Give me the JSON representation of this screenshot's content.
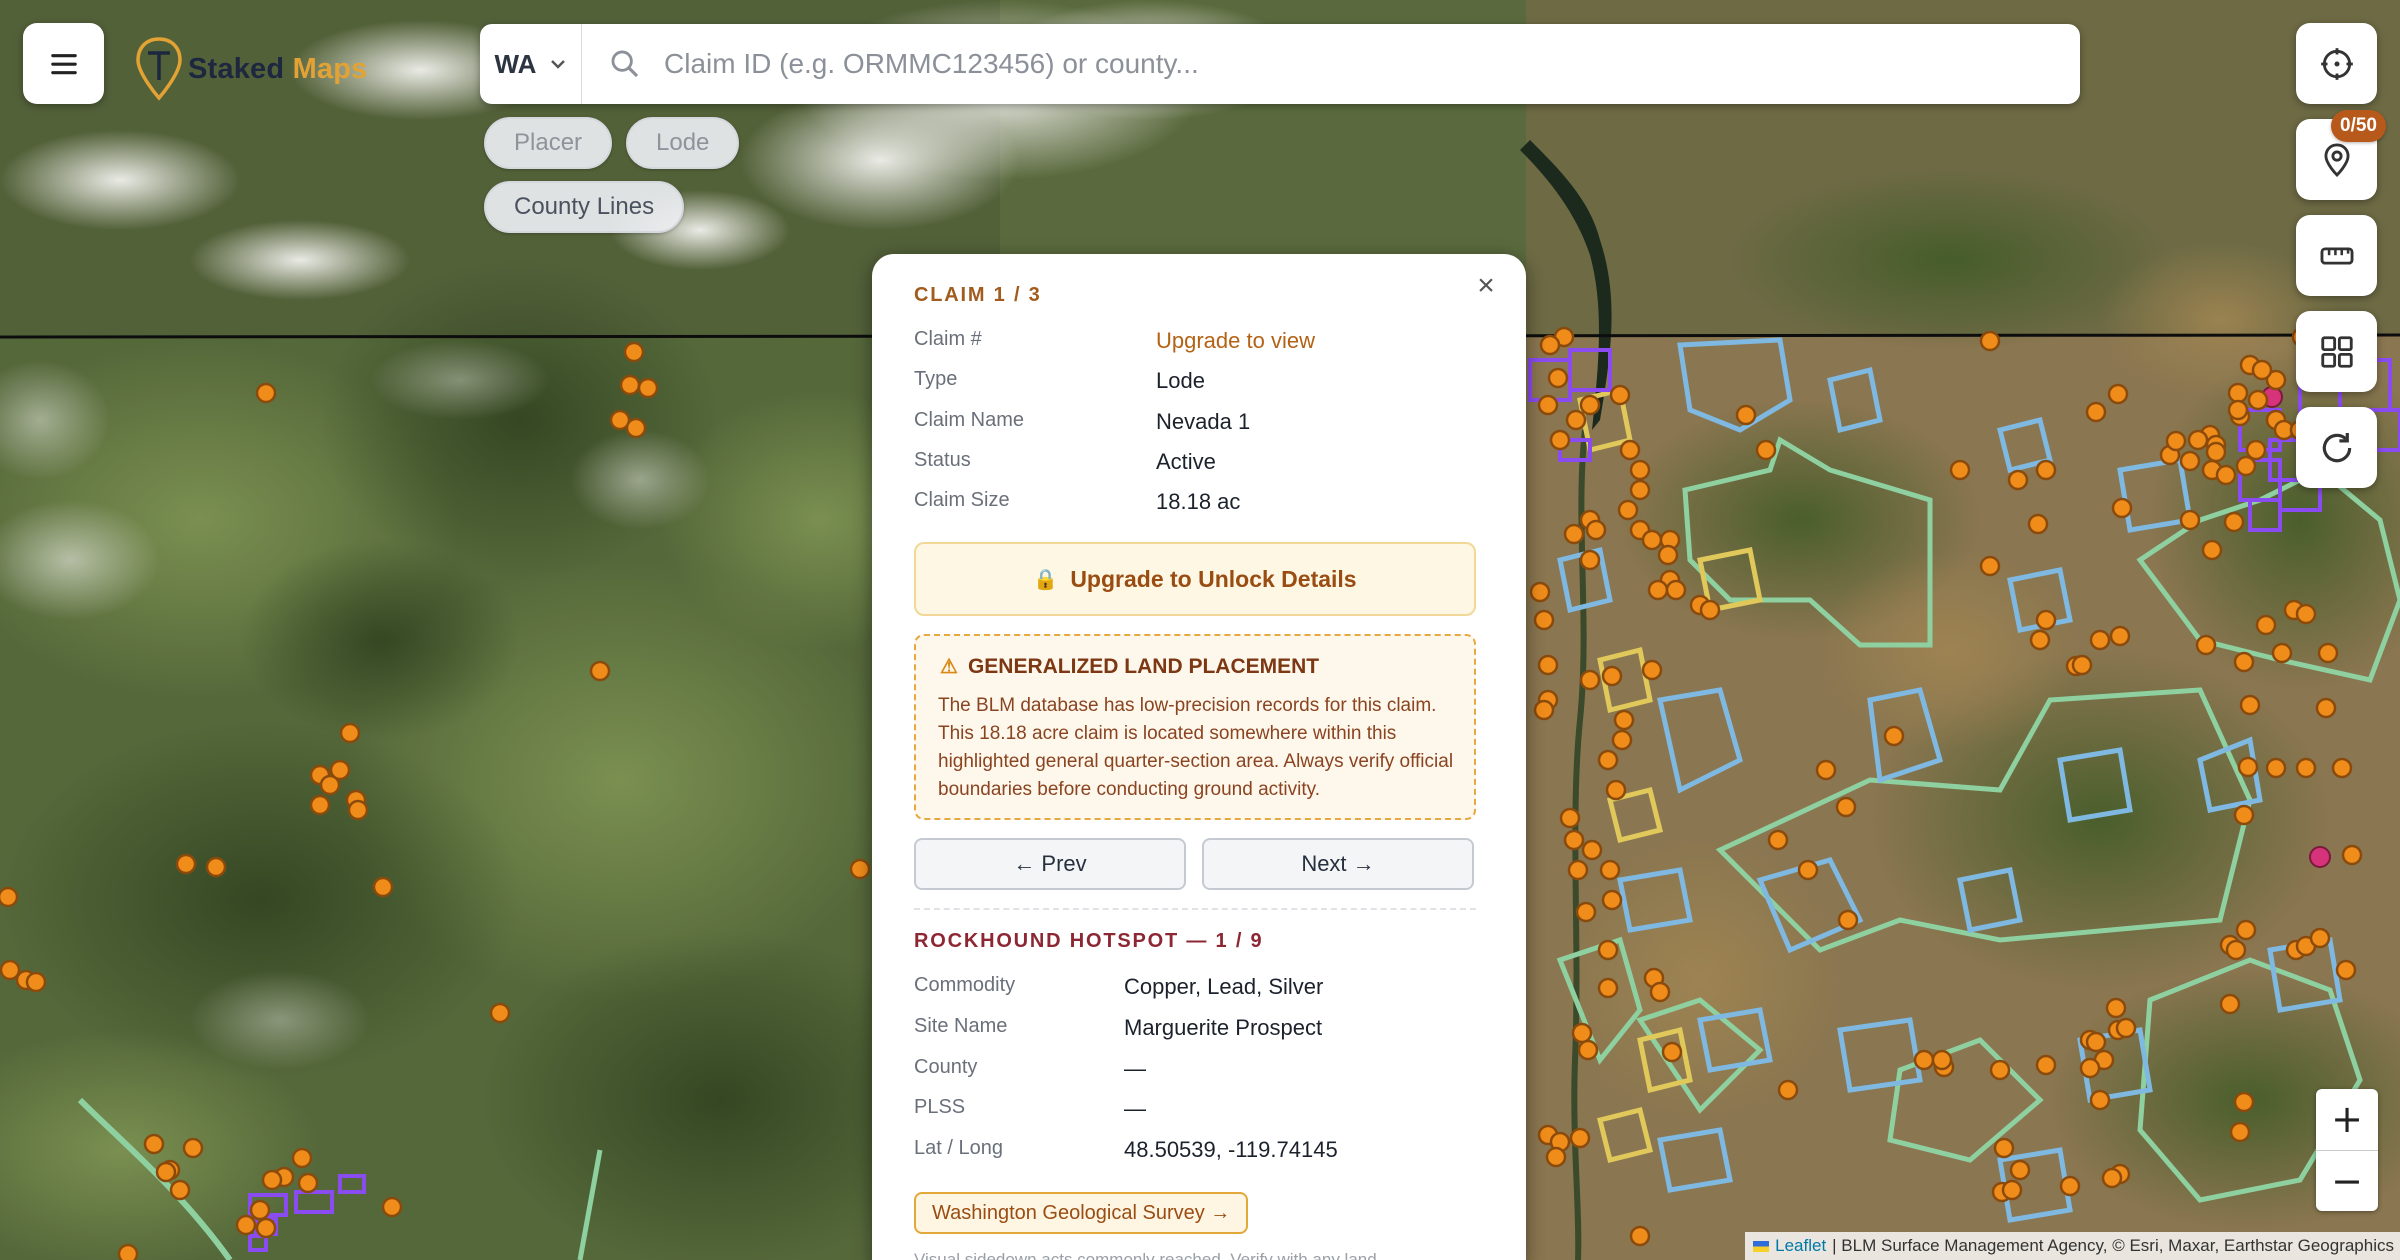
{
  "header": {
    "brand_word1": "Staked",
    "brand_word2": "Maps",
    "state": "WA",
    "search_placeholder": "Claim ID (e.g. ORMMC123456) or county..."
  },
  "filters": {
    "placer": "Placer",
    "lode": "Lode",
    "county_lines": "County Lines"
  },
  "toolbar": {
    "saved_count": "0/50",
    "icons": [
      "crosshair-icon",
      "map-pin-icon",
      "ruler-icon",
      "grid-icon",
      "refresh-icon"
    ]
  },
  "zoom": {
    "in": "+",
    "out": "−"
  },
  "attribution": {
    "leaflet": "Leaflet",
    "rest": "| BLM Surface Management Agency, © Esri, Maxar, Earthstar Geographics"
  },
  "popup": {
    "close": "×",
    "claim_title": "CLAIM 1 / 3",
    "claim_fields": [
      {
        "label": "Claim #",
        "value": "Upgrade to view"
      },
      {
        "label": "Type",
        "value": "Lode"
      },
      {
        "label": "Claim Name",
        "value": "Nevada 1"
      },
      {
        "label": "Status",
        "value": "Active"
      },
      {
        "label": "Claim Size",
        "value": "18.18 ac"
      }
    ],
    "unlock_label": "Upgrade to Unlock Details",
    "warning_title": "GENERALIZED LAND PLACEMENT",
    "warning_text": "The BLM database has low-precision records for this claim. This 18.18 acre claim is located somewhere within this highlighted general quarter-section area. Always verify official boundaries before conducting ground activity.",
    "prev_label": "← Prev",
    "next_label": "Next →",
    "hotspot_title": "ROCKHOUND HOTSPOT — 1 / 9",
    "hotspot_fields": [
      {
        "label": "Commodity",
        "value": "Copper, Lead, Silver"
      },
      {
        "label": "Site Name",
        "value": "Marguerite Prospect"
      },
      {
        "label": "County",
        "value": "—"
      },
      {
        "label": "PLSS",
        "value": "—"
      },
      {
        "label": "Lat / Long",
        "value": "48.50539, -119.74145"
      }
    ],
    "survey_label": "Washington Geological Survey →",
    "footnote": "Visual sidedown acts commonly reached. Verify with any land"
  },
  "colors": {
    "accent": "#e2a234",
    "brand_dark": "#1d2740",
    "claim_title": "#a15c1e",
    "hotspot_title": "#8c2733",
    "marker_fill": "#f08c1a",
    "marker_stroke": "#8a4a0c",
    "claim_polygon": "#8a4cf0",
    "blm_blue": "#7fb8e0",
    "blm_green": "#8ed0a0",
    "blm_yellow": "#e0c85a",
    "hotspot_magenta": "#d6337a"
  }
}
